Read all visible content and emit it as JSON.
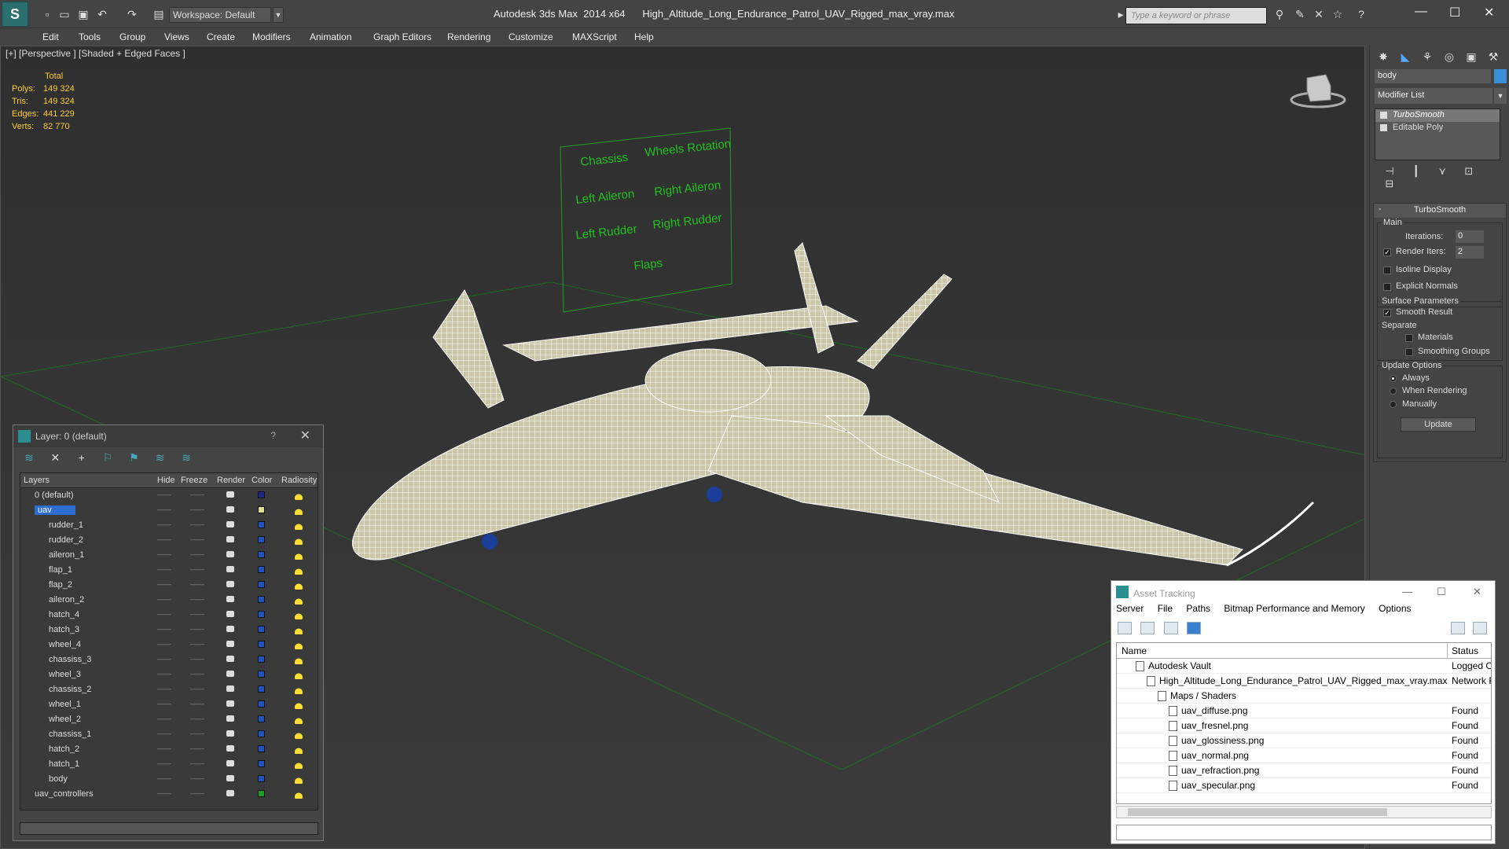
{
  "app": {
    "title": "Autodesk 3ds Max  2014 x64      High_Altitude_Long_Endurance_Patrol_UAV_Rigged_max_vray.max",
    "workspace": "Workspace: Default",
    "search_placeholder": "Type a keyword or phrase"
  },
  "menu": [
    "Edit",
    "Tools",
    "Group",
    "Views",
    "Create",
    "Modifiers",
    "Animation",
    "Graph Editors",
    "Rendering",
    "Customize",
    "MAXScript",
    "Help"
  ],
  "viewport": {
    "label": "[+] [Perspective ] [Shaded + Edged Faces ]",
    "stats": {
      "header": "Total",
      "polys_label": "Polys:",
      "polys": "149 324",
      "tris_label": "Tris:",
      "tris": "149 324",
      "edges_label": "Edges:",
      "edges": "441 229",
      "verts_label": "Verts:",
      "verts": "82 770"
    },
    "controller_board": {
      "labels": [
        "Chassiss",
        "Wheels Rotation",
        "Left Aileron",
        "Right Aileron",
        "Left Rudder",
        "Right Rudder",
        "Flaps"
      ]
    }
  },
  "layer_window": {
    "title": "Layer: 0 (default)",
    "columns": [
      "Layers",
      "Hide",
      "Freeze",
      "Render",
      "Color",
      "Radiosity"
    ],
    "rows": [
      {
        "name": "0 (default)",
        "indent": 0,
        "color": "#1b2a8a"
      },
      {
        "name": "uav",
        "indent": 0,
        "color": "#e0e090",
        "selected": true
      },
      {
        "name": "rudder_1",
        "indent": 1,
        "color": "#1f55c0"
      },
      {
        "name": "rudder_2",
        "indent": 1,
        "color": "#1f55c0"
      },
      {
        "name": "aileron_1",
        "indent": 1,
        "color": "#1f55c0"
      },
      {
        "name": "flap_1",
        "indent": 1,
        "color": "#1f55c0"
      },
      {
        "name": "flap_2",
        "indent": 1,
        "color": "#1f55c0"
      },
      {
        "name": "aileron_2",
        "indent": 1,
        "color": "#1f55c0"
      },
      {
        "name": "hatch_4",
        "indent": 1,
        "color": "#1f55c0"
      },
      {
        "name": "hatch_3",
        "indent": 1,
        "color": "#1f55c0"
      },
      {
        "name": "wheel_4",
        "indent": 1,
        "color": "#1f55c0"
      },
      {
        "name": "chassiss_3",
        "indent": 1,
        "color": "#1f55c0"
      },
      {
        "name": "wheel_3",
        "indent": 1,
        "color": "#1f55c0"
      },
      {
        "name": "chassiss_2",
        "indent": 1,
        "color": "#1f55c0"
      },
      {
        "name": "wheel_1",
        "indent": 1,
        "color": "#1f55c0"
      },
      {
        "name": "wheel_2",
        "indent": 1,
        "color": "#1f55c0"
      },
      {
        "name": "chassiss_1",
        "indent": 1,
        "color": "#1f55c0"
      },
      {
        "name": "hatch_2",
        "indent": 1,
        "color": "#1f55c0"
      },
      {
        "name": "hatch_1",
        "indent": 1,
        "color": "#1f55c0"
      },
      {
        "name": "body",
        "indent": 1,
        "color": "#1f55c0"
      },
      {
        "name": "uav_controllers",
        "indent": 0,
        "color": "#1fa020"
      }
    ]
  },
  "command_panel": {
    "object_name": "body",
    "object_color": "#3a8fd8",
    "modifier_list": "Modifier List",
    "stack": [
      "TurboSmooth",
      "Editable Poly"
    ],
    "rollout_title": "TurboSmooth",
    "main_label": "Main",
    "iterations_label": "Iterations:",
    "iterations": "0",
    "render_iters_label": "Render Iters:",
    "render_iters": "2",
    "isoline_label": "Isoline Display",
    "explicit_normals_label": "Explicit Normals",
    "surface_params_label": "Surface Parameters",
    "smooth_result_label": "Smooth Result",
    "separate_label": "Separate",
    "materials_label": "Materials",
    "smoothing_groups_label": "Smoothing Groups",
    "update_options_label": "Update Options",
    "always_label": "Always",
    "when_rendering_label": "When Rendering",
    "manually_label": "Manually",
    "update_button": "Update"
  },
  "asset_tracking": {
    "title": "Asset Tracking",
    "menu": [
      "Server",
      "File",
      "Paths",
      "Bitmap Performance and Memory",
      "Options"
    ],
    "columns": [
      "Name",
      "Status"
    ],
    "rows": [
      {
        "name": "Autodesk Vault",
        "status": "Logged O",
        "indent": 1
      },
      {
        "name": "High_Altitude_Long_Endurance_Patrol_UAV_Rigged_max_vray.max",
        "status": "Network F",
        "indent": 2
      },
      {
        "name": "Maps / Shaders",
        "status": "",
        "indent": 3
      },
      {
        "name": "uav_diffuse.png",
        "status": "Found",
        "indent": 4
      },
      {
        "name": "uav_fresnel.png",
        "status": "Found",
        "indent": 4
      },
      {
        "name": "uav_glossiness.png",
        "status": "Found",
        "indent": 4
      },
      {
        "name": "uav_normal.png",
        "status": "Found",
        "indent": 4
      },
      {
        "name": "uav_refraction.png",
        "status": "Found",
        "indent": 4
      },
      {
        "name": "uav_specular.png",
        "status": "Found",
        "indent": 4
      }
    ]
  }
}
